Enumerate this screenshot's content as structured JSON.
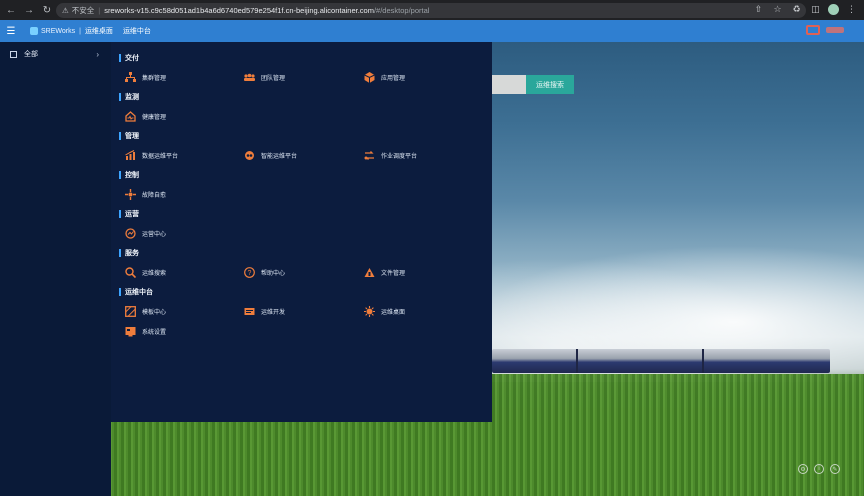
{
  "browser": {
    "security_label": "不安全",
    "url_host": "sreworks-v15.c9c58d051ad1b4a6d6740ed579e254f1f.cn-beijing.alicontainer.com",
    "url_path": "/#/desktop/portal"
  },
  "header": {
    "brand": "SREWorks",
    "links": [
      "运维桌面",
      "运维中台"
    ]
  },
  "sidebar": {
    "items": [
      {
        "label": "全部"
      }
    ]
  },
  "search": {
    "button_label": "运维搜索"
  },
  "menu": {
    "groups": [
      {
        "title": "交付",
        "items": [
          {
            "label": "集群管理",
            "icon": "cluster-icon"
          },
          {
            "label": "团队管理",
            "icon": "team-icon"
          },
          {
            "label": "应用管理",
            "icon": "app-icon"
          }
        ]
      },
      {
        "title": "监测",
        "items": [
          {
            "label": "健康管理",
            "icon": "health-icon"
          }
        ]
      },
      {
        "title": "管理",
        "items": [
          {
            "label": "数据运维平台",
            "icon": "data-ops-icon"
          },
          {
            "label": "智能运维平台",
            "icon": "aiops-icon"
          },
          {
            "label": "作业调度平台",
            "icon": "job-schedule-icon"
          }
        ]
      },
      {
        "title": "控制",
        "items": [
          {
            "label": "故障自愈",
            "icon": "self-heal-icon"
          }
        ]
      },
      {
        "title": "运营",
        "items": [
          {
            "label": "运营中心",
            "icon": "operations-icon"
          }
        ]
      },
      {
        "title": "服务",
        "items": [
          {
            "label": "运维搜索",
            "icon": "search-icon"
          },
          {
            "label": "帮助中心",
            "icon": "help-icon"
          },
          {
            "label": "文件管理",
            "icon": "file-icon"
          }
        ]
      },
      {
        "title": "运维中台",
        "items": [
          {
            "label": "模板中心",
            "icon": "template-icon"
          },
          {
            "label": "运维开发",
            "icon": "devops-icon"
          },
          {
            "label": "运维桌面",
            "icon": "desktop-icon"
          },
          {
            "label": "系统设置",
            "icon": "settings-icon"
          }
        ]
      }
    ]
  },
  "colors": {
    "header_bg": "#2f7fd1",
    "menu_bg": "#0c1c3e",
    "icon_accent": "#ef7d3c",
    "group_bar": "#3da4ff",
    "search_btn": "#2aa79b"
  }
}
